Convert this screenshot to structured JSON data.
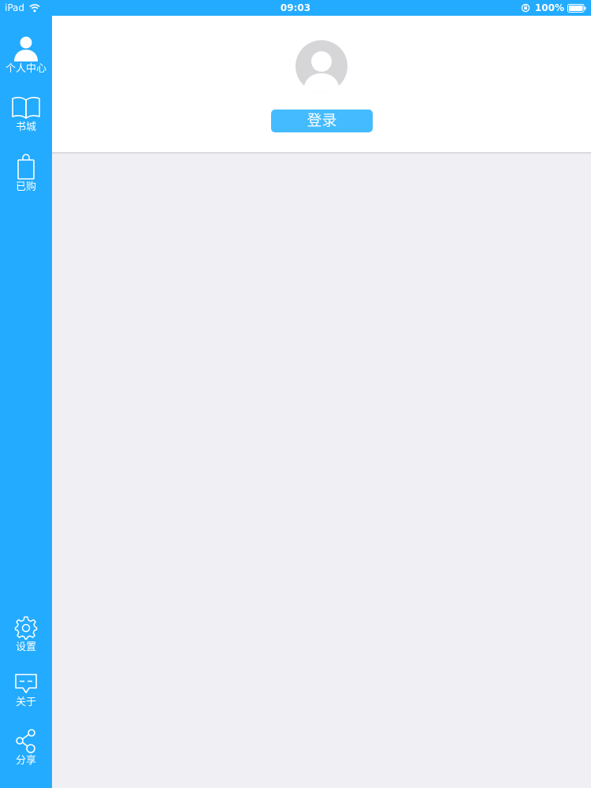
{
  "status_bar": {
    "device": "iPad",
    "time": "09:03",
    "battery": "100%",
    "icons": [
      "wifi-icon",
      "orientation-lock-icon",
      "battery-icon"
    ]
  },
  "sidebar": {
    "items": [
      {
        "label": "个人中心",
        "icon": "person-icon"
      },
      {
        "label": "书城",
        "icon": "book-icon"
      },
      {
        "label": "已购",
        "icon": "shopping-bag-icon"
      },
      {
        "label": "设置",
        "icon": "gear-icon"
      },
      {
        "label": "关于",
        "icon": "chat-bubble-icon"
      },
      {
        "label": "分享",
        "icon": "share-icon"
      }
    ]
  },
  "profile": {
    "avatar_icon": "default-avatar-icon",
    "login_label": "登录"
  },
  "colors": {
    "accent": "#23abff",
    "button": "#44bbff",
    "background": "#f0eff4",
    "header": "#ffffff"
  }
}
